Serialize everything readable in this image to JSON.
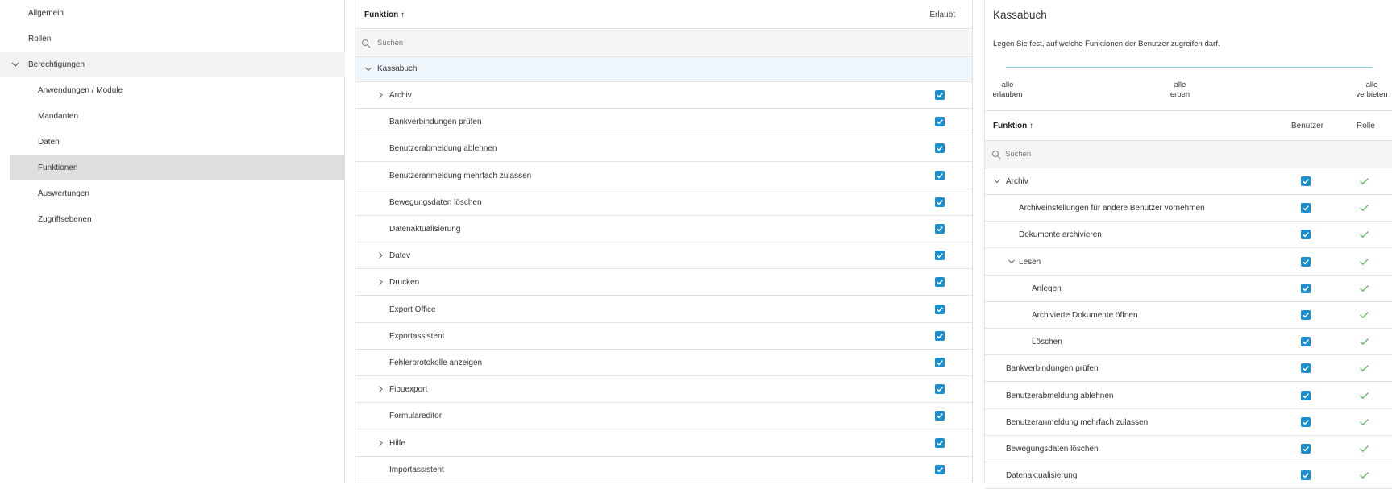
{
  "nav": {
    "items": [
      {
        "label": "Allgemein"
      },
      {
        "label": "Rollen"
      },
      {
        "label": "Berechtigungen"
      },
      {
        "label": "Anwendungen / Module"
      },
      {
        "label": "Mandanten"
      },
      {
        "label": "Daten"
      },
      {
        "label": "Funktionen"
      },
      {
        "label": "Auswertungen"
      },
      {
        "label": "Zugriffsebenen"
      }
    ]
  },
  "mid": {
    "col_function": "Funktion ↑",
    "col_allowed": "Erlaubt",
    "search_placeholder": "Suchen",
    "group": "Kassabuch",
    "rows": [
      {
        "label": "Archiv",
        "expandable": true,
        "allowed": true
      },
      {
        "label": "Bankverbindungen prüfen",
        "expandable": false,
        "allowed": true
      },
      {
        "label": "Benutzerabmeldung ablehnen",
        "expandable": false,
        "allowed": true
      },
      {
        "label": "Benutzeranmeldung mehrfach zulassen",
        "expandable": false,
        "allowed": true
      },
      {
        "label": "Bewegungsdaten löschen",
        "expandable": false,
        "allowed": true
      },
      {
        "label": "Datenaktualisierung",
        "expandable": false,
        "allowed": true
      },
      {
        "label": "Datev",
        "expandable": true,
        "allowed": true
      },
      {
        "label": "Drucken",
        "expandable": true,
        "allowed": true
      },
      {
        "label": "Export Office",
        "expandable": false,
        "allowed": true
      },
      {
        "label": "Exportassistent",
        "expandable": false,
        "allowed": true
      },
      {
        "label": "Fehlerprotokolle anzeigen",
        "expandable": false,
        "allowed": true
      },
      {
        "label": "Fibuexport",
        "expandable": true,
        "allowed": true
      },
      {
        "label": "Formulareditor",
        "expandable": false,
        "allowed": true
      },
      {
        "label": "Hilfe",
        "expandable": true,
        "allowed": true
      },
      {
        "label": "Importassistent",
        "expandable": false,
        "allowed": true
      }
    ]
  },
  "right": {
    "title": "Kassabuch",
    "description": "Legen Sie fest, auf welche Funktionen der Benutzer zugreifen darf.",
    "slider": {
      "allow_1": "alle",
      "allow_2": "erlauben",
      "inherit_1": "alle",
      "inherit_2": "erben",
      "deny_1": "alle",
      "deny_2": "verbieten"
    },
    "col_function": "Funktion ↑",
    "col_user": "Benutzer",
    "col_role": "Rolle",
    "search_placeholder": "Suchen",
    "rows": [
      {
        "label": "Archiv",
        "level": 0,
        "chevron": "down",
        "user": true,
        "role": true
      },
      {
        "label": "Archiveinstellungen für andere Benutzer vornehmen",
        "level": 1,
        "chevron": "none",
        "user": true,
        "role": true
      },
      {
        "label": "Dokumente archivieren",
        "level": 1,
        "chevron": "none",
        "user": true,
        "role": true
      },
      {
        "label": "Lesen",
        "level": 1,
        "chevron": "down",
        "user": true,
        "role": true
      },
      {
        "label": "Anlegen",
        "level": 2,
        "chevron": "none",
        "user": true,
        "role": true
      },
      {
        "label": "Archivierte Dokumente öffnen",
        "level": 2,
        "chevron": "none",
        "user": true,
        "role": true
      },
      {
        "label": "Löschen",
        "level": 2,
        "chevron": "none",
        "user": true,
        "role": true
      },
      {
        "label": "Bankverbindungen prüfen",
        "level": 0,
        "chevron": "none",
        "user": true,
        "role": true
      },
      {
        "label": "Benutzerabmeldung ablehnen",
        "level": 0,
        "chevron": "none",
        "user": true,
        "role": true
      },
      {
        "label": "Benutzeranmeldung mehrfach zulassen",
        "level": 0,
        "chevron": "none",
        "user": true,
        "role": true
      },
      {
        "label": "Bewegungsdaten löschen",
        "level": 0,
        "chevron": "none",
        "user": true,
        "role": true
      },
      {
        "label": "Datenaktualisierung",
        "level": 0,
        "chevron": "none",
        "user": true,
        "role": true
      }
    ]
  },
  "colors": {
    "checkbox": "#1a8fd0",
    "role_check": "#5cb85c",
    "slider": "#7fd0e6"
  }
}
